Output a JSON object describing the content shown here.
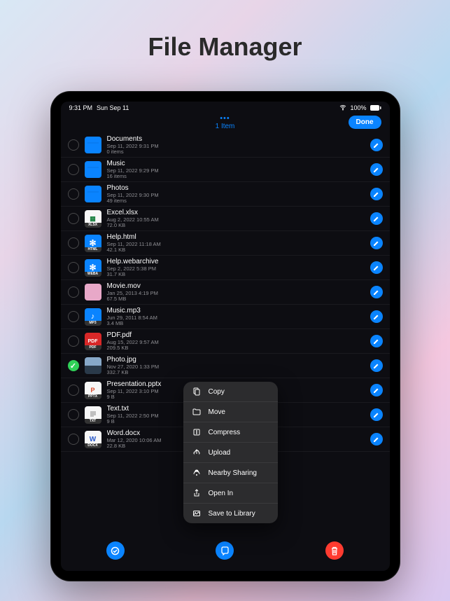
{
  "marketing_title": "File Manager",
  "status": {
    "time": "9:31 PM",
    "date": "Sun Sep 11",
    "battery": "100%"
  },
  "nav": {
    "count_label": "1 Item",
    "done_label": "Done"
  },
  "files": [
    {
      "name": "Documents",
      "date": "Sep 11, 2022 9:31 PM",
      "size": "0 items",
      "type": "folder",
      "selected": false
    },
    {
      "name": "Music",
      "date": "Sep 11, 2022 9:29 PM",
      "size": "16 items",
      "type": "folder",
      "selected": false
    },
    {
      "name": "Photos",
      "date": "Sep 11, 2022 9:30 PM",
      "size": "49 items",
      "type": "folder",
      "selected": false
    },
    {
      "name": "Excel.xlsx",
      "date": "Aug 2, 2022 10:55 AM",
      "size": "72.0 KB",
      "type": "xlsx",
      "selected": false
    },
    {
      "name": "Help.html",
      "date": "Sep 11, 2022 11:18 AM",
      "size": "42.1 KB",
      "type": "html",
      "selected": false
    },
    {
      "name": "Help.webarchive",
      "date": "Sep 2, 2022 5:38 PM",
      "size": "31.7 KB",
      "type": "weba",
      "selected": false
    },
    {
      "name": "Movie.mov",
      "date": "Jan 25, 2013 4:19 PM",
      "size": "67.5 MB",
      "type": "mov",
      "selected": false
    },
    {
      "name": "Music.mp3",
      "date": "Jun 29, 2011 8:54 AM",
      "size": "3.4 MB",
      "type": "mp3",
      "selected": false
    },
    {
      "name": "PDF.pdf",
      "date": "Aug 15, 2022 9:57 AM",
      "size": "209.5 KB",
      "type": "pdf",
      "selected": false
    },
    {
      "name": "Photo.jpg",
      "date": "Nov 27, 2020 1:33 PM",
      "size": "332.7 KB",
      "type": "jpg",
      "selected": true
    },
    {
      "name": "Presentation.pptx",
      "date": "Sep 11, 2022 3:10 PM",
      "size": "9 B",
      "type": "pptx",
      "selected": false
    },
    {
      "name": "Text.txt",
      "date": "Sep 11, 2022 2:50 PM",
      "size": "9 B",
      "type": "txt",
      "selected": false
    },
    {
      "name": "Word.docx",
      "date": "Mar 12, 2020 10:06 AM",
      "size": "22.8 KB",
      "type": "docx",
      "selected": false
    }
  ],
  "menu": {
    "items": [
      {
        "icon": "copy",
        "label": "Copy"
      },
      {
        "icon": "move",
        "label": "Move"
      },
      {
        "icon": "compress",
        "label": "Compress"
      },
      {
        "icon": "upload",
        "label": "Upload"
      },
      {
        "icon": "share",
        "label": "Nearby Sharing"
      },
      {
        "icon": "open",
        "label": "Open In"
      },
      {
        "icon": "save",
        "label": "Save to Library"
      }
    ]
  }
}
